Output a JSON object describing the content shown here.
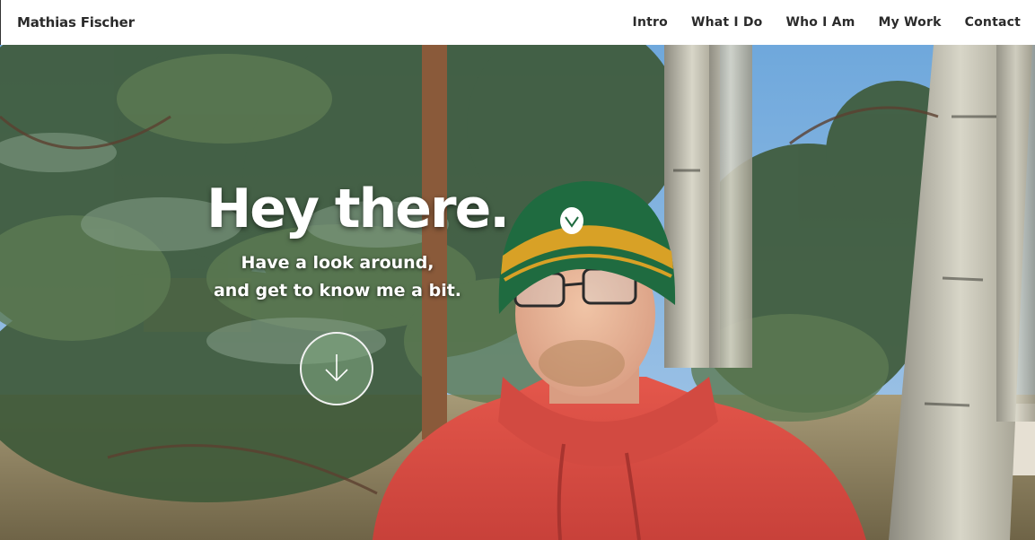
{
  "navbar": {
    "brand": "Mathias Fischer",
    "links": [
      {
        "label": "Intro"
      },
      {
        "label": "What I Do"
      },
      {
        "label": "Who I Am"
      },
      {
        "label": "My Work"
      },
      {
        "label": "Contact"
      }
    ]
  },
  "hero": {
    "title": "Hey there.",
    "subtitle_line1": "Have a look around,",
    "subtitle_line2": "and get to know me a bit.",
    "scroll_icon": "arrow-down-icon",
    "background_image": "photo-portrait-in-forest"
  },
  "colors": {
    "nav_text": "#2b2b2b",
    "hero_text": "#ffffff"
  }
}
